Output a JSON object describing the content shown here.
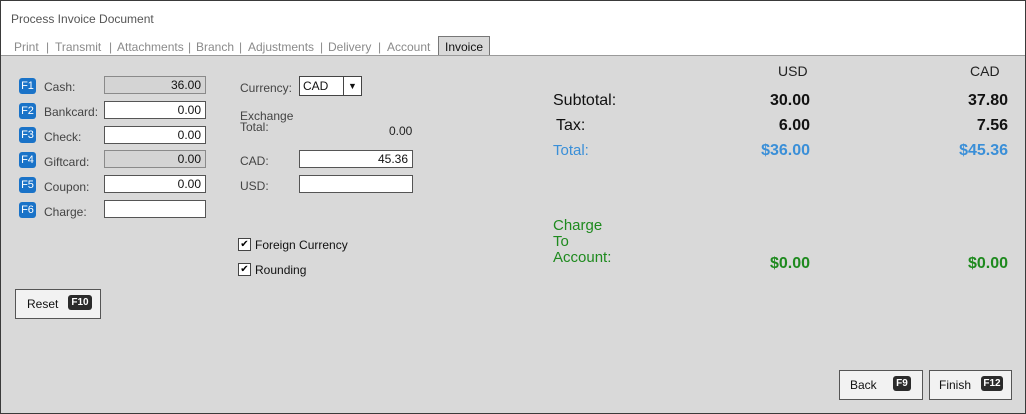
{
  "window": {
    "title": "Process Invoice Document"
  },
  "tabs": [
    "Print",
    "Transmit",
    "Attachments",
    "Branch",
    "Adjustments",
    "Delivery",
    "Account",
    "Invoice"
  ],
  "payments": [
    {
      "key": "F1",
      "label": "Cash:",
      "value": "36.00",
      "disabled": true
    },
    {
      "key": "F2",
      "label": "Bankcard:",
      "value": "0.00",
      "disabled": false
    },
    {
      "key": "F3",
      "label": "Check:",
      "value": "0.00",
      "disabled": false
    },
    {
      "key": "F4",
      "label": "Giftcard:",
      "value": "0.00",
      "disabled": true
    },
    {
      "key": "F5",
      "label": "Coupon:",
      "value": "0.00",
      "disabled": false
    },
    {
      "key": "F6",
      "label": "Charge:",
      "value": "",
      "disabled": false
    }
  ],
  "currency": {
    "label": "Currency:",
    "selected": "CAD",
    "exchange_label_1": "Exchange",
    "exchange_label_2": "Total:",
    "exchange_total": "0.00",
    "cad_label": "CAD:",
    "cad_value": "45.36",
    "usd_label": "USD:",
    "usd_value": ""
  },
  "options": {
    "foreign_currency": {
      "label": "Foreign Currency",
      "checked": true
    },
    "rounding": {
      "label": "Rounding",
      "checked": true
    }
  },
  "summary": {
    "col_usd": "USD",
    "col_cad": "CAD",
    "subtotal_label": "Subtotal:",
    "subtotal_usd": "30.00",
    "subtotal_cad": "37.80",
    "tax_label": "Tax:",
    "tax_usd": "6.00",
    "tax_cad": "7.56",
    "total_label": "Total:",
    "total_usd": "$36.00",
    "total_cad": "$45.36",
    "charge_label_1": "Charge",
    "charge_label_2": "To",
    "charge_label_3": "Account:",
    "charge_usd": "$0.00",
    "charge_cad": "$0.00"
  },
  "buttons": {
    "reset": {
      "label": "Reset",
      "key": "F10"
    },
    "back": {
      "label": "Back",
      "key": "F9"
    },
    "finish": {
      "label": "Finish",
      "key": "F12"
    }
  },
  "colors": {
    "fkey_blue": "#1a73c8",
    "total_blue": "#3a8fd8",
    "charge_green": "#1e8a1e",
    "panel_gray": "#d9d9d9"
  }
}
